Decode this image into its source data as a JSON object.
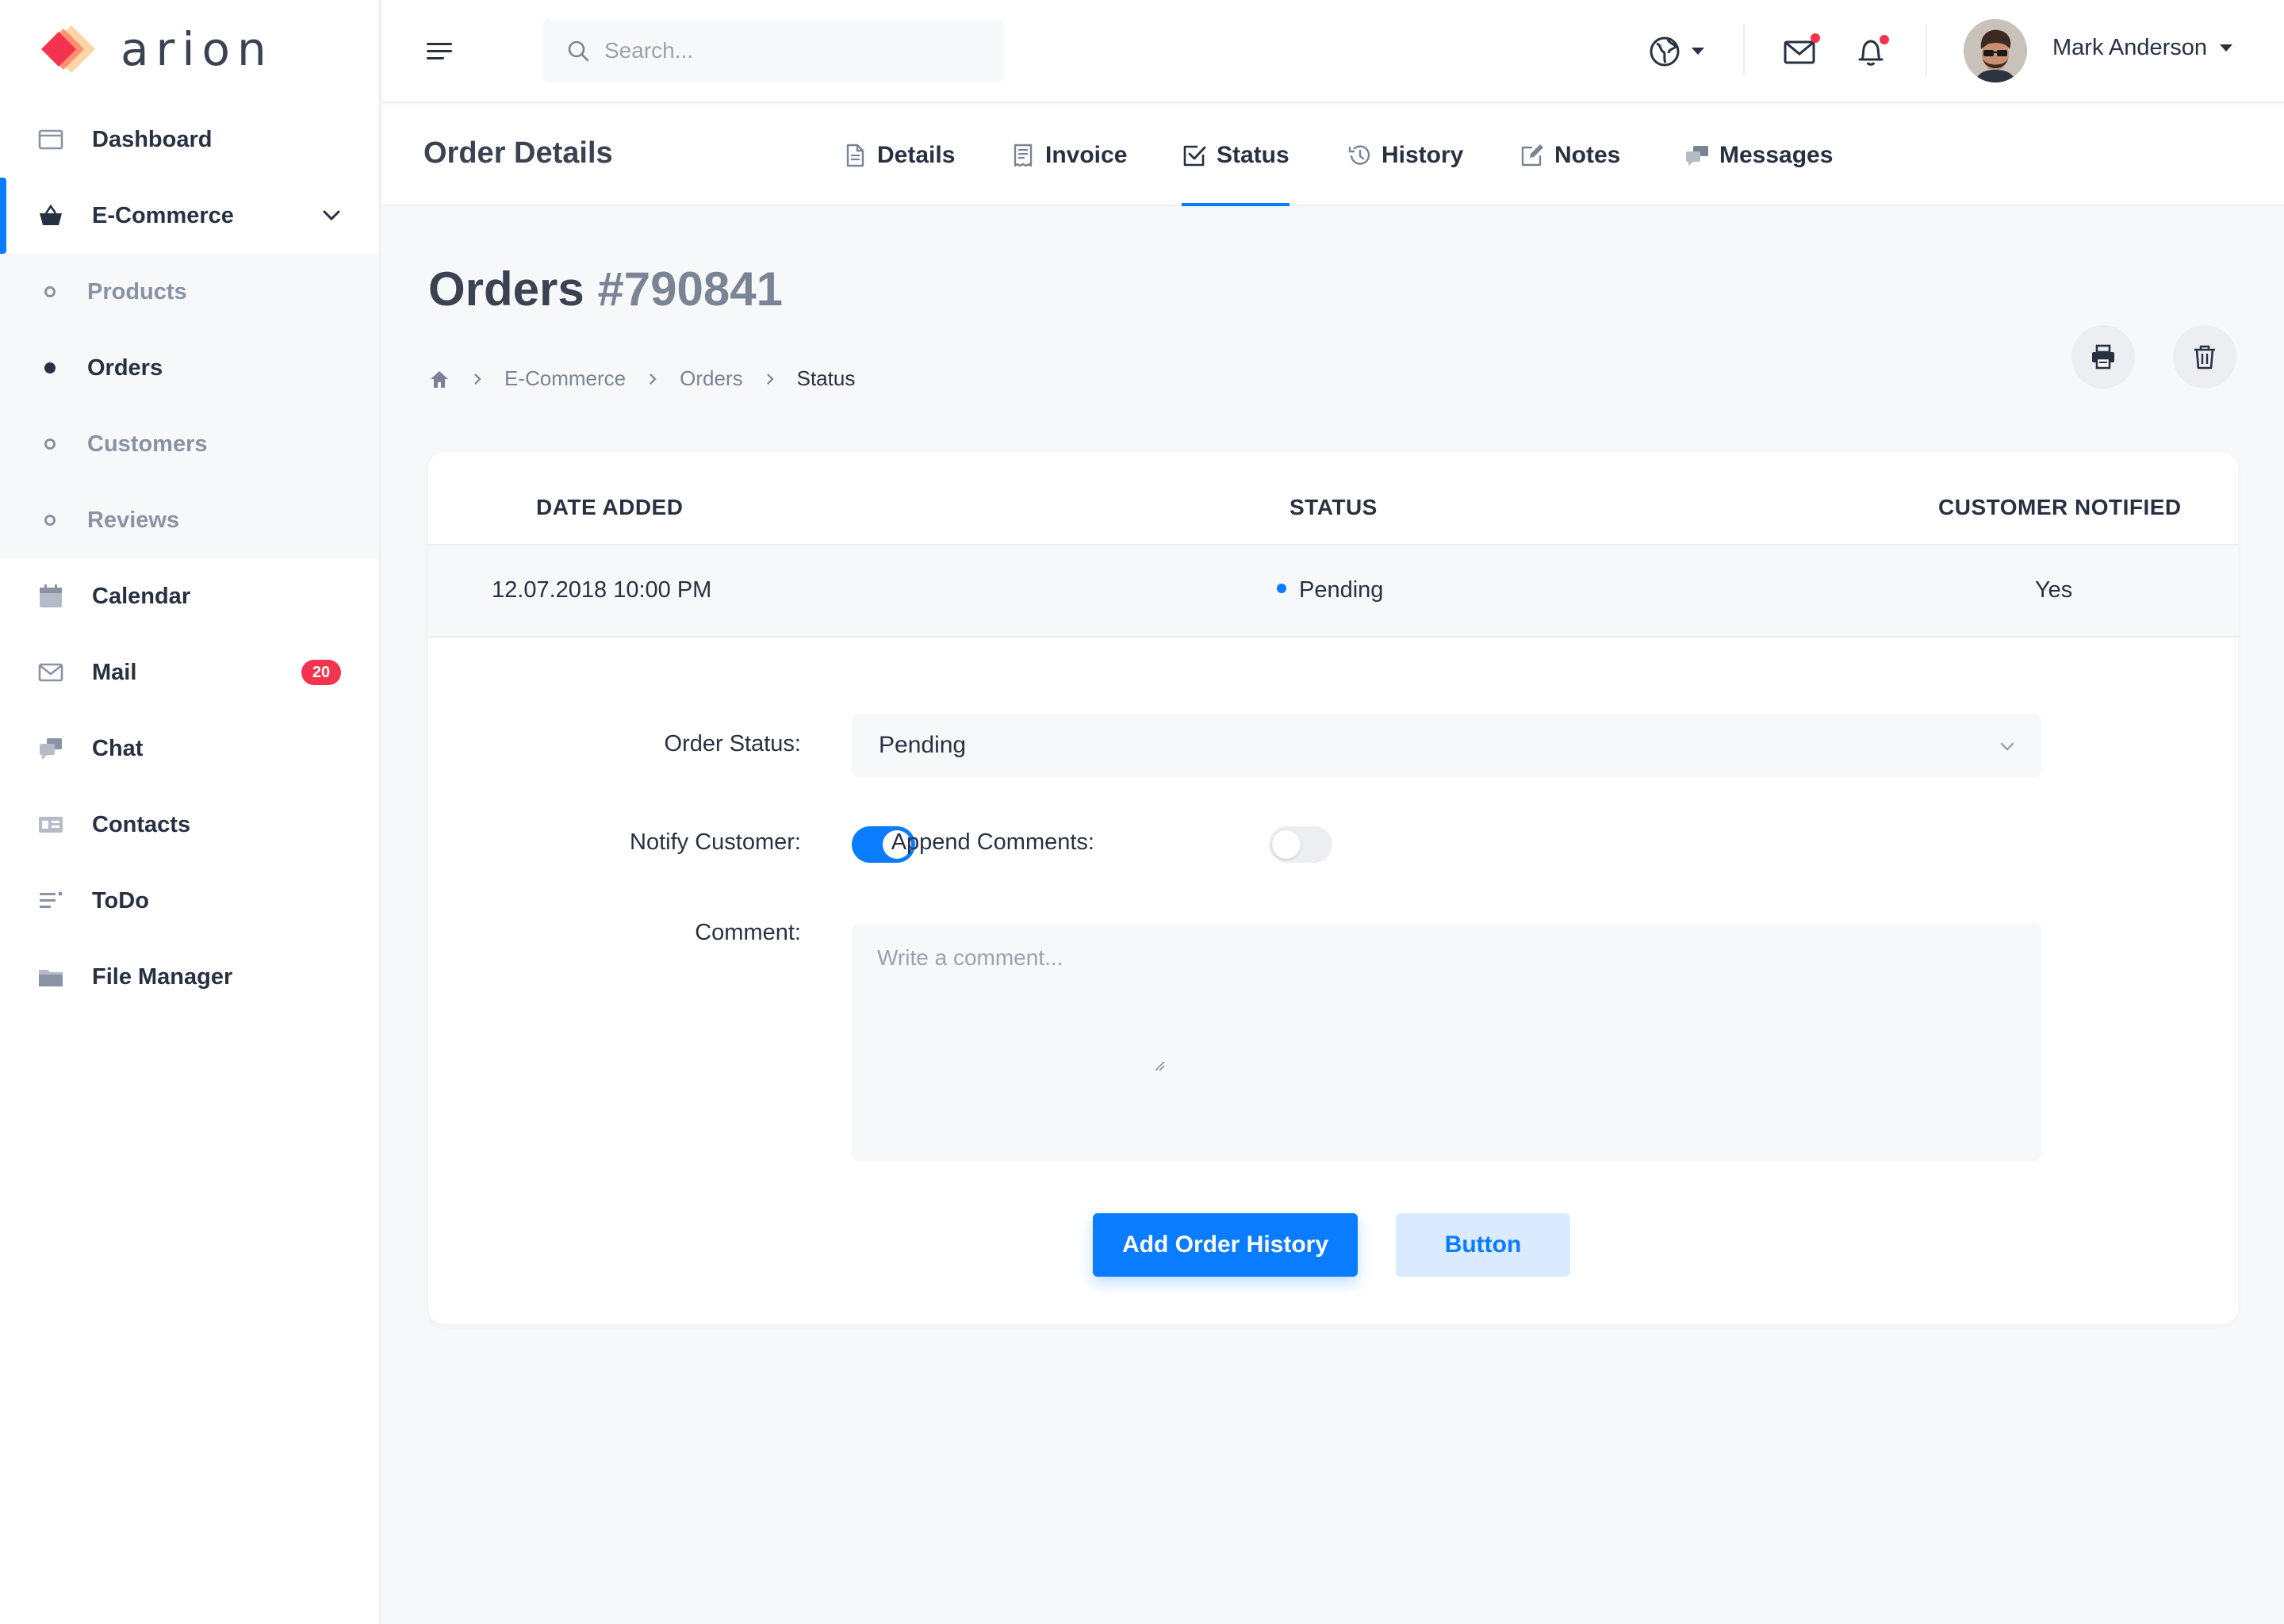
{
  "brand": {
    "name": "arion"
  },
  "sidebar": {
    "items": [
      {
        "label": "Dashboard",
        "icon": "dashboard-icon"
      },
      {
        "label": "E-Commerce",
        "icon": "basket-icon",
        "expanded": true,
        "children": [
          {
            "label": "Products",
            "current": false
          },
          {
            "label": "Orders",
            "current": true
          },
          {
            "label": "Customers",
            "current": false
          },
          {
            "label": "Reviews",
            "current": false
          }
        ]
      },
      {
        "label": "Calendar",
        "icon": "calendar-icon"
      },
      {
        "label": "Mail",
        "icon": "mail-icon",
        "badge": "20"
      },
      {
        "label": "Chat",
        "icon": "chat-icon"
      },
      {
        "label": "Contacts",
        "icon": "contacts-icon"
      },
      {
        "label": "ToDo",
        "icon": "todo-icon"
      },
      {
        "label": "File Manager",
        "icon": "folder-icon"
      }
    ]
  },
  "topbar": {
    "search_placeholder": "Search...",
    "user_name": "Mark Anderson"
  },
  "subheader": {
    "title": "Order Details",
    "tabs": [
      {
        "label": "Details",
        "icon": "document-icon"
      },
      {
        "label": "Invoice",
        "icon": "receipt-icon"
      },
      {
        "label": "Status",
        "icon": "checkbox-icon",
        "active": true
      },
      {
        "label": "History",
        "icon": "history-icon"
      },
      {
        "label": "Notes",
        "icon": "edit-icon"
      },
      {
        "label": "Messages",
        "icon": "messages-icon"
      }
    ]
  },
  "page": {
    "title": "Orders",
    "order_number": "#790841",
    "breadcrumb": [
      "E-Commerce",
      "Orders",
      "Status"
    ]
  },
  "table": {
    "headers": [
      "DATE ADDED",
      "STATUS",
      "CUSTOMER NOTIFIED"
    ],
    "rows": [
      {
        "date": "12.07.2018 10:00 PM",
        "status": "Pending",
        "notified": "Yes"
      }
    ]
  },
  "form": {
    "order_status_label": "Order Status:",
    "order_status_value": "Pending",
    "notify_label": "Notify Customer:",
    "notify_on": true,
    "append_label": "Append Comments:",
    "append_on": false,
    "comment_label": "Comment:",
    "comment_placeholder": "Write a comment...",
    "primary_button": "Add Order History",
    "secondary_button": "Button"
  },
  "colors": {
    "accent": "#0a7cff",
    "badge": "#f4344f",
    "text": "#273142",
    "muted": "#7a8494"
  }
}
